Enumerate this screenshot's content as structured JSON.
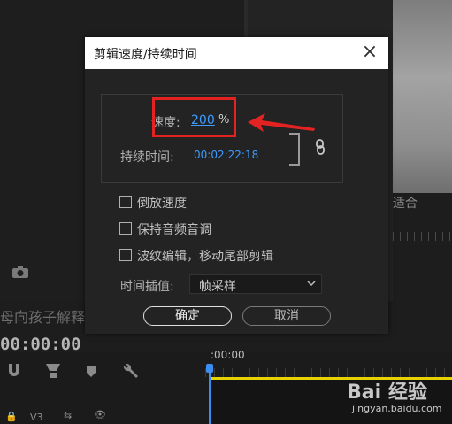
{
  "dialog": {
    "title": "剪辑速度/持续时间",
    "speed_label": "速度:",
    "speed_value": "200",
    "speed_unit": "%",
    "duration_label": "持续时间:",
    "duration_value": "00:02:22:18",
    "reverse_label": "倒放速度",
    "maintain_pitch_label": "保持音频音调",
    "ripple_edit_label": "波纹编辑，移动尾部剪辑",
    "interpolation_label": "时间插值:",
    "interpolation_value": "帧采样",
    "ok_label": "确定",
    "cancel_label": "取消"
  },
  "background": {
    "fit_label": "适合",
    "sequence_title": "母向孩子解释",
    "timecode": "00:00:00",
    "ruler_timecode": ":00:00",
    "track_label": "V3"
  },
  "watermark": {
    "logo": "Bai 经验",
    "url": "jingyan.baidu.com"
  },
  "colors": {
    "accent_blue": "#3e9bff",
    "annotation_red": "#e32222",
    "timeline_yellow": "#e6d200"
  }
}
